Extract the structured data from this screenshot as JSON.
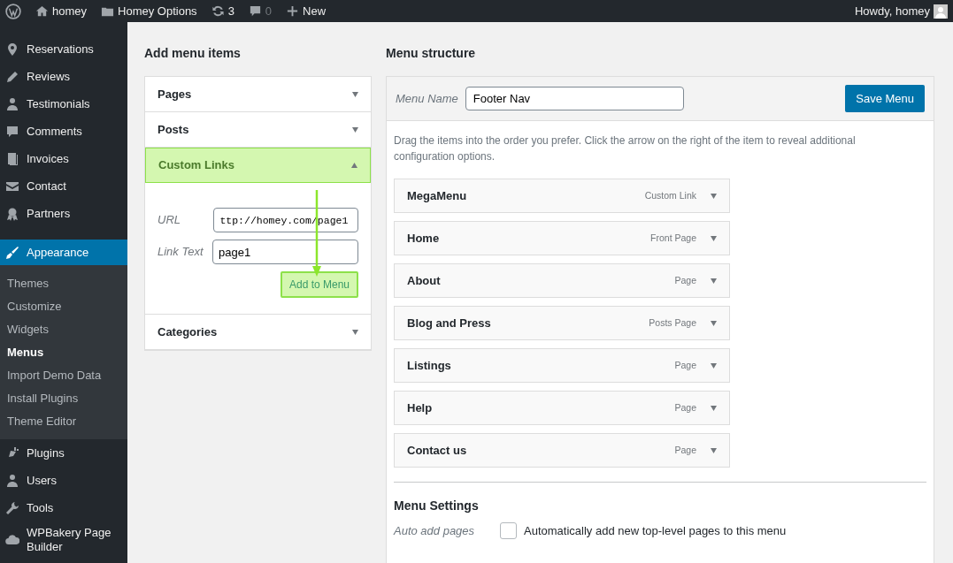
{
  "admin_bar": {
    "items": [
      {
        "kind": "logo"
      },
      {
        "kind": "home",
        "label": "homey"
      },
      {
        "kind": "folder",
        "label": "Homey Options"
      },
      {
        "kind": "updates",
        "label": "3"
      },
      {
        "kind": "comments",
        "label": "0"
      },
      {
        "kind": "new",
        "label": "New"
      }
    ],
    "account": "Howdy, homey"
  },
  "sidebar": {
    "items": [
      {
        "label": "Reservations",
        "selected": false
      },
      {
        "label": "Reviews",
        "selected": false
      },
      {
        "label": "Testimonials",
        "selected": false
      },
      {
        "label": "Comments",
        "selected": false
      },
      {
        "label": "Invoices",
        "selected": false
      },
      {
        "label": "Contact",
        "selected": false
      },
      {
        "label": "Partners",
        "selected": false
      },
      {
        "label": "Appearance",
        "selected": true,
        "children": [
          {
            "label": "Themes",
            "selected": false
          },
          {
            "label": "Customize",
            "selected": false
          },
          {
            "label": "Widgets",
            "selected": false
          },
          {
            "label": "Menus",
            "selected": true
          },
          {
            "label": "Import Demo Data",
            "selected": false
          },
          {
            "label": "Install Plugins",
            "selected": false
          },
          {
            "label": "Theme Editor",
            "selected": false
          }
        ]
      },
      {
        "label": "Plugins",
        "selected": false
      },
      {
        "label": "Users",
        "selected": false
      },
      {
        "label": "Tools",
        "selected": false
      },
      {
        "label": "WPBakery Page Builder",
        "selected": false
      }
    ]
  },
  "add_menu_items": {
    "title": "Add menu items",
    "sections": [
      {
        "title": "Pages",
        "expanded": false,
        "highlighted": false
      },
      {
        "title": "Posts",
        "expanded": false,
        "highlighted": false
      },
      {
        "title": "Custom Links",
        "expanded": true,
        "highlighted": true,
        "fields": [
          {
            "label": "URL",
            "value": "ttp://homey.com/page1"
          },
          {
            "label": "Link Text",
            "value": "page1"
          }
        ],
        "button": {
          "label": "Add to Menu",
          "highlighted": true
        }
      },
      {
        "title": "Categories",
        "expanded": false,
        "highlighted": false
      }
    ]
  },
  "menu_structure": {
    "title": "Menu structure",
    "menu_name_label": "Menu Name",
    "menu_name": "Footer Nav",
    "save_button": "Save Menu",
    "instructions": "Drag the items into the order you prefer. Click the arrow on the right of the item to reveal additional configuration options.",
    "items": [
      {
        "title": "MegaMenu",
        "type": "Custom Link"
      },
      {
        "title": "Home",
        "type": "Front Page"
      },
      {
        "title": "About",
        "type": "Page"
      },
      {
        "title": "Blog and Press",
        "type": "Posts Page"
      },
      {
        "title": "Listings",
        "type": "Page"
      },
      {
        "title": "Help",
        "type": "Page"
      },
      {
        "title": "Contact us",
        "type": "Page"
      }
    ],
    "settings_title": "Menu Settings",
    "settings": [
      {
        "label": "Auto add pages",
        "text": "Automatically add new top-level pages to this menu",
        "checked": false
      }
    ]
  }
}
